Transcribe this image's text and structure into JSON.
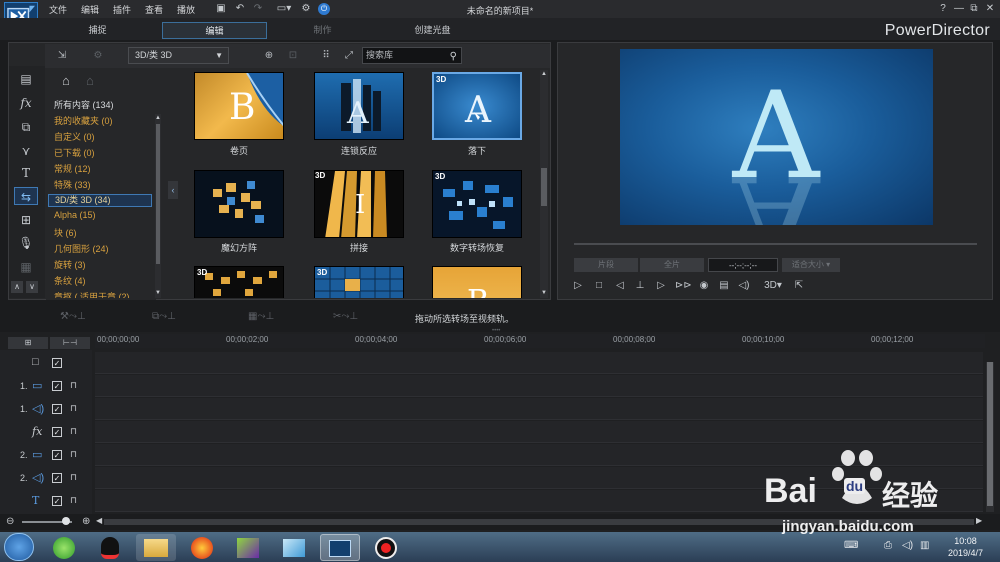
{
  "menu": [
    "文件",
    "编辑",
    "插件",
    "查看",
    "播放"
  ],
  "title": "未命名的新项目*",
  "window_controls": [
    "?",
    "—",
    "⧉",
    "✕"
  ],
  "modes": {
    "capture": "捕捉",
    "edit": "编辑",
    "produce": "制作",
    "disc": "创建光盘"
  },
  "brand": "PowerDirector",
  "library": {
    "dropdown": "3D/类 3D",
    "search_placeholder": "搜索库",
    "categories": [
      {
        "label": "所有内容 (134)",
        "type": "all"
      },
      {
        "label": "我的收藏夹 (0)",
        "type": "cat"
      },
      {
        "label": "自定义 (0)",
        "type": "cat"
      },
      {
        "label": "已下载 (0)",
        "type": "cat"
      },
      {
        "label": "常规 (12)",
        "type": "cat"
      },
      {
        "label": "特殊 (33)",
        "type": "cat"
      },
      {
        "label": "3D/类 3D (34)",
        "type": "sel"
      },
      {
        "label": "Alpha (15)",
        "type": "cat"
      },
      {
        "label": "块 (6)",
        "type": "cat"
      },
      {
        "label": "几何图形 (24)",
        "type": "cat"
      },
      {
        "label": "旋转 (3)",
        "type": "cat"
      },
      {
        "label": "条纹 (4)",
        "type": "cat"
      },
      {
        "label": "章抠 ( 适用于章 (2)",
        "type": "cat"
      }
    ],
    "thumbnails": [
      {
        "label": "卷页",
        "badge": ""
      },
      {
        "label": "连锁反应",
        "badge": ""
      },
      {
        "label": "落下",
        "badge": "3D"
      },
      {
        "label": "魔幻方阵",
        "badge": ""
      },
      {
        "label": "拼接",
        "badge": "3D"
      },
      {
        "label": "数字转场恢复",
        "badge": "3D"
      },
      {
        "label": "",
        "badge": "3D"
      },
      {
        "label": "",
        "badge": "3D"
      },
      {
        "label": "",
        "badge": ""
      }
    ]
  },
  "preview": {
    "letter": "A",
    "clip_btn": "片段",
    "movie_btn": "全片",
    "timecode": "--;--;--;--",
    "fit": "适合大小",
    "mode3d": "3D"
  },
  "hint": "拖动所选转场至视频轨。",
  "ruler": [
    "00;00;00;00",
    "00;00;02;00",
    "00;00;04;00",
    "00;00;06;00",
    "00;00;08;00",
    "00;00;10;00",
    "00;00;12;00"
  ],
  "tracks": [
    {
      "num": "",
      "icon": "master-icon"
    },
    {
      "num": "1.",
      "icon": "video-track-icon"
    },
    {
      "num": "1.",
      "icon": "audio-track-icon"
    },
    {
      "num": "",
      "icon": "fx-track-icon"
    },
    {
      "num": "2.",
      "icon": "video-track-icon"
    },
    {
      "num": "2.",
      "icon": "audio-track-icon"
    },
    {
      "num": "",
      "icon": "title-track-icon"
    }
  ],
  "fx_glyph": "fx",
  "title_glyph": "T",
  "clock": {
    "time": "10:08",
    "date": "2019/4/7"
  },
  "watermark": {
    "brand": "Bai",
    "suffix": "经验",
    "url": "jingyan.baidu.com"
  }
}
